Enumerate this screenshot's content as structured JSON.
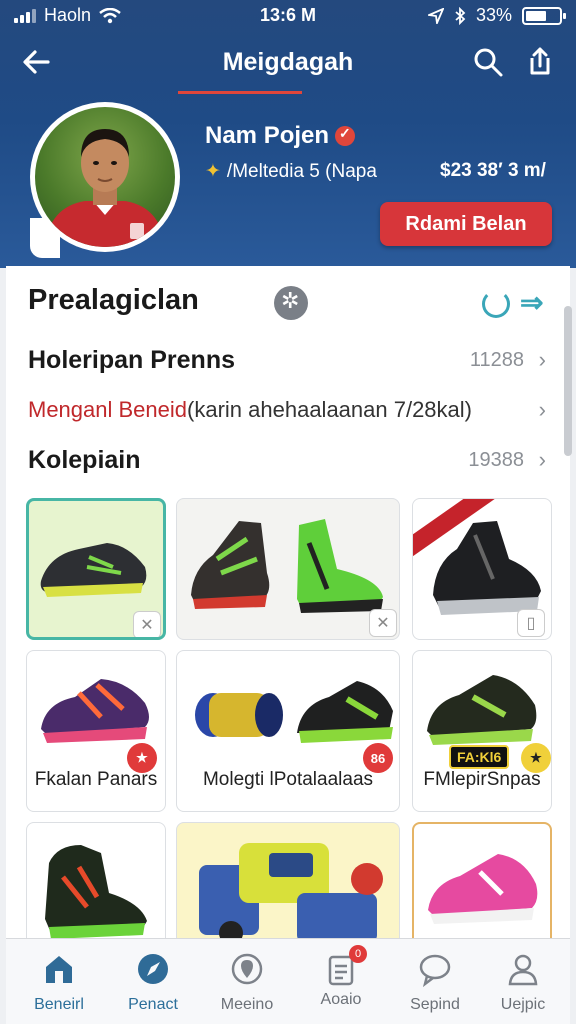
{
  "status_bar": {
    "carrier": "Haoln",
    "time": "13:6 M",
    "battery": "33%"
  },
  "header": {
    "title": "Meigdagah"
  },
  "profile": {
    "name": "Nam Pojen",
    "subtitle": "/Meltedia 5 (Napa",
    "price": "$23 38′ 3 m/",
    "cta_label": "Rdami Belan"
  },
  "section": {
    "title": "Prealagiclan",
    "rows": [
      {
        "label": "Holeripan Prenns",
        "value": "11288"
      },
      {
        "label_red": "Menganl Beneid",
        "label_rest": "(karin ahehaalaanan 7/28kal)"
      },
      {
        "label": "Kolepiain",
        "value": "19388"
      }
    ]
  },
  "products": [
    {
      "caption": ""
    },
    {
      "caption": ""
    },
    {
      "caption": ""
    },
    {
      "caption": "Fkalan Panars",
      "badge": ""
    },
    {
      "caption": "Molegti lPotalaalaas",
      "badge": "86"
    },
    {
      "caption": "FMlepirSnpas",
      "tag": "FA:Kl6"
    },
    {
      "caption": ""
    },
    {
      "caption": ""
    },
    {
      "caption": ""
    }
  ],
  "tabs": [
    {
      "label": "Beneirl",
      "icon": "home-icon"
    },
    {
      "label": "Penact",
      "icon": "compass-icon"
    },
    {
      "label": "Meeino",
      "icon": "location-icon"
    },
    {
      "label": "Aoaio",
      "icon": "clipboard-icon",
      "badge": "0"
    },
    {
      "label": "Sepind",
      "icon": "chat-icon"
    },
    {
      "label": "Uejpic",
      "icon": "user-icon"
    }
  ],
  "colors": {
    "header_blue": "#24497e",
    "accent_red": "#d7363a",
    "teal": "#3aa6b8"
  }
}
